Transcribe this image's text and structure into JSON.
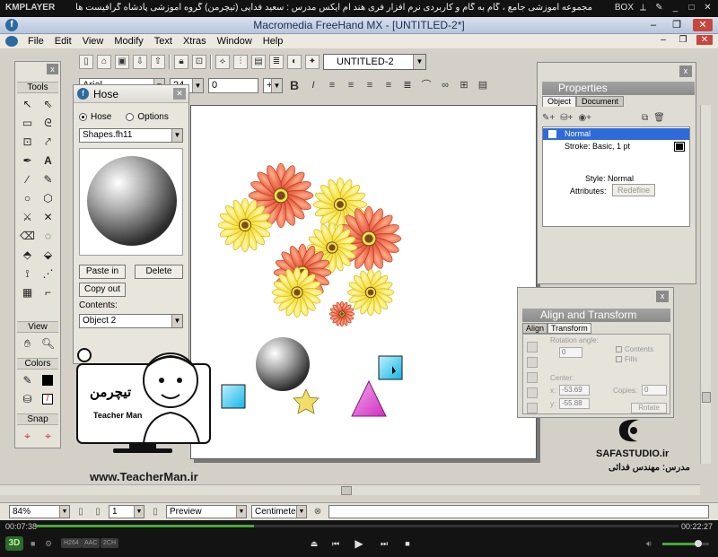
{
  "player": {
    "logo": "KMPLAYER",
    "title": "مجموعه آموزشی جامع ، گام به گام و کاربردی نرم افزار فری هند ام ایکس  مدرس : سعید فدایی (تیچرمن) گروه آموزشی پادشاه گرافیست ها",
    "box_label": "BOX",
    "time_elapsed": "00:07:38",
    "time_total": "00:22:27",
    "badge_3d": "3D",
    "codec_badges": [
      "H264",
      "AAC",
      "2CH"
    ],
    "progress": 0.34,
    "volume": 0.77
  },
  "app": {
    "title": "Macromedia FreeHand MX - [UNTITLED-2*]",
    "menu": [
      "File",
      "Edit",
      "View",
      "Modify",
      "Text",
      "Xtras",
      "Window",
      "Help"
    ]
  },
  "toolbar": {
    "document_select": "UNTITLED-2"
  },
  "text_toolbar": {
    "font": "Arial",
    "size": "24",
    "leading": "0",
    "leading_mode": "+"
  },
  "tools": {
    "title": "Tools",
    "view_label": "View",
    "colors_label": "Colors",
    "snap_label": "Snap"
  },
  "hose": {
    "title": "Hose",
    "radio_hose": "Hose",
    "radio_options": "Options",
    "file": "Shapes.fh11",
    "paste_in": "Paste in",
    "delete": "Delete",
    "copy_out": "Copy out",
    "contents_label": "Contents:",
    "contents_value": "Object 2"
  },
  "properties": {
    "title": "Properties",
    "tab_object": "Object",
    "tab_document": "Document",
    "row_selected": "Normal",
    "row_stroke": "Stroke: Basic, 1 pt",
    "style_label": "Style:",
    "style_value": "Normal",
    "attributes_label": "Attributes:",
    "redefine": "Redefine"
  },
  "align_transform": {
    "title": "Align and Transform",
    "tab_align": "Align",
    "tab_transform": "Transform",
    "rotation_label": "Rotation angle:",
    "rotation_value": "0",
    "contents_label": "Contents",
    "fills_label": "Fills",
    "center_label": "Center:",
    "cx_label": "x:",
    "cx_value": "-53.69",
    "cy_label": "y:",
    "cy_value": "-55.88",
    "copies_label": "Copies:",
    "copies_value": "0",
    "rotate_button": "Rotate"
  },
  "statusbar": {
    "zoom": "84%",
    "page": "1",
    "preview_mode": "Preview",
    "units": "Centimeters"
  },
  "watermark": {
    "teacher_url": "www.TeacherMan.ir",
    "teacher_name": "Teacher Man",
    "teacher_fa": "تیچرمن",
    "safa": "SAFASTUDIO.ir",
    "safa_sub": "مدرس: مهندس فدائی"
  },
  "colors": {
    "accent_selected": "#2f6bd8",
    "flower_red": "#e0452e",
    "flower_yellow": "#f9e11a",
    "square_cyan": "#27c8f0",
    "triangle_magenta": "#e34fd2",
    "star_yellow": "#f2dd6a"
  }
}
